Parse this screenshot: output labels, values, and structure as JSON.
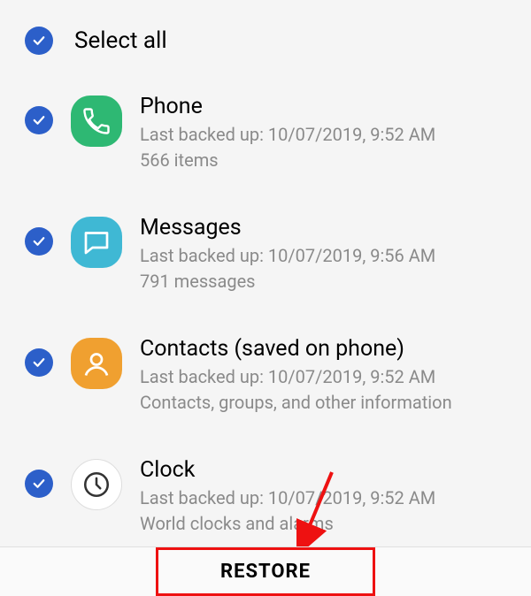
{
  "select_all": {
    "label": "Select all"
  },
  "items": [
    {
      "title": "Phone",
      "backup_line": "Last backed up: 10/07/2019, 9:52 AM",
      "detail": "566 items"
    },
    {
      "title": "Messages",
      "backup_line": "Last backed up: 10/07/2019, 9:56 AM",
      "detail": "791 messages"
    },
    {
      "title": "Contacts (saved on phone)",
      "backup_line": "Last backed up: 10/07/2019, 9:52 AM",
      "detail": "Contacts, groups, and other information"
    },
    {
      "title": "Clock",
      "backup_line": "Last backed up: 10/07/2019, 9:52 AM",
      "detail": "World clocks and alarms"
    }
  ],
  "footer": {
    "restore_label": "RESTORE"
  }
}
